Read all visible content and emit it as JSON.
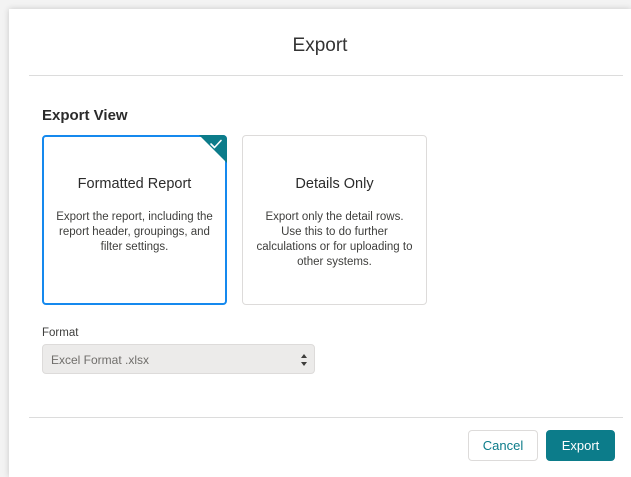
{
  "dialog": {
    "title": "Export"
  },
  "export_view": {
    "heading": "Export View",
    "options": [
      {
        "title": "Formatted Report",
        "description": "Export the report, including the report header, groupings, and filter settings.",
        "selected": true
      },
      {
        "title": "Details Only",
        "description": "Export only the detail rows. Use this to do further calculations or for uploading to other systems.",
        "selected": false
      }
    ]
  },
  "format": {
    "label": "Format",
    "selected_value": "Excel Format .xlsx"
  },
  "footer": {
    "cancel_label": "Cancel",
    "export_label": "Export"
  },
  "colors": {
    "accent": "#0c7c8a",
    "selected_border": "#1589ee"
  },
  "icons": {
    "selected_indicator": "check-icon",
    "select_arrows": "up-down-arrows-icon"
  }
}
